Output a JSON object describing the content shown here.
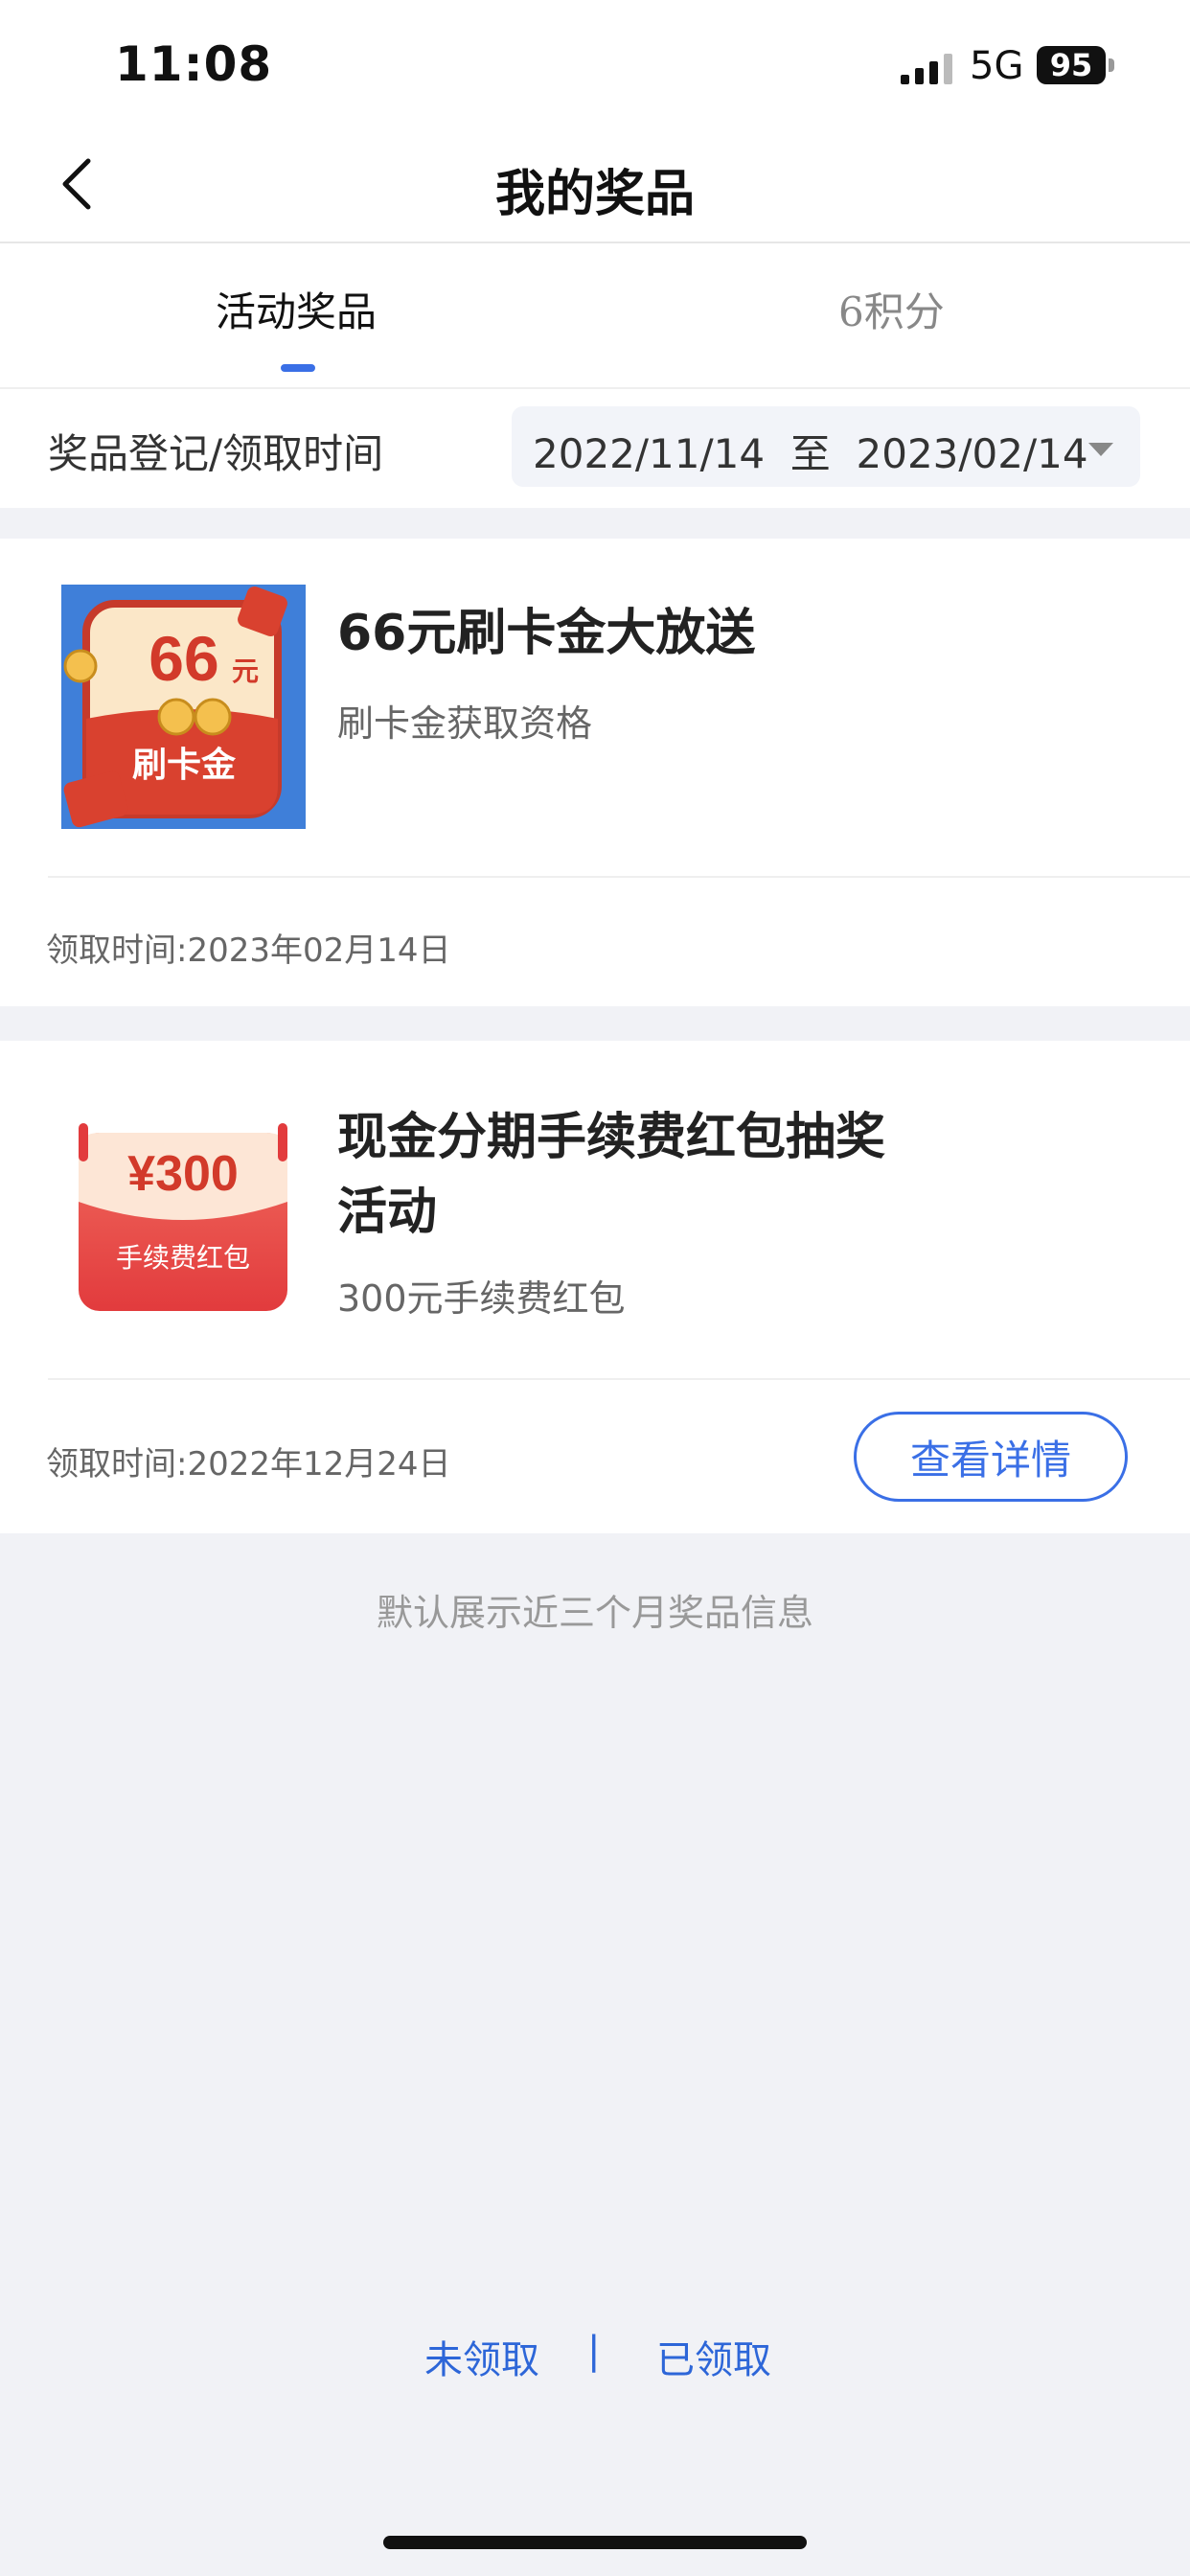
{
  "status_bar": {
    "time": "11:08",
    "network": "5G",
    "battery": "95"
  },
  "nav": {
    "title": "我的奖品"
  },
  "tabs": [
    {
      "label": "活动奖品",
      "active": true
    },
    {
      "label": "6积分",
      "active": false
    }
  ],
  "filter": {
    "label": "奖品登记/领取时间",
    "start_date": "2022/11/14",
    "separator": "至",
    "end_date": "2023/02/14"
  },
  "prizes": [
    {
      "image_text": {
        "amount": "66",
        "unit": "元",
        "caption": "刷卡金"
      },
      "title": "66元刷卡金大放送",
      "subtitle": "刷卡金获取资格",
      "claim_time": "领取时间:2023年02月14日"
    },
    {
      "image_text": {
        "amount": "¥300",
        "caption": "手续费红包"
      },
      "title_line1": "现金分期手续费红包抽奖",
      "title_line2": "活动",
      "subtitle": "300元手续费红包",
      "claim_time": "领取时间:2022年12月24日",
      "action_label": "查看详情"
    }
  ],
  "footer": {
    "note": "默认展示近三个月奖品信息",
    "link_unclaimed": "未领取",
    "separator": "|",
    "link_claimed": "已领取"
  },
  "colors": {
    "accent": "#3a6fe6",
    "background": "#f1f2f6",
    "red": "#e2453a"
  }
}
